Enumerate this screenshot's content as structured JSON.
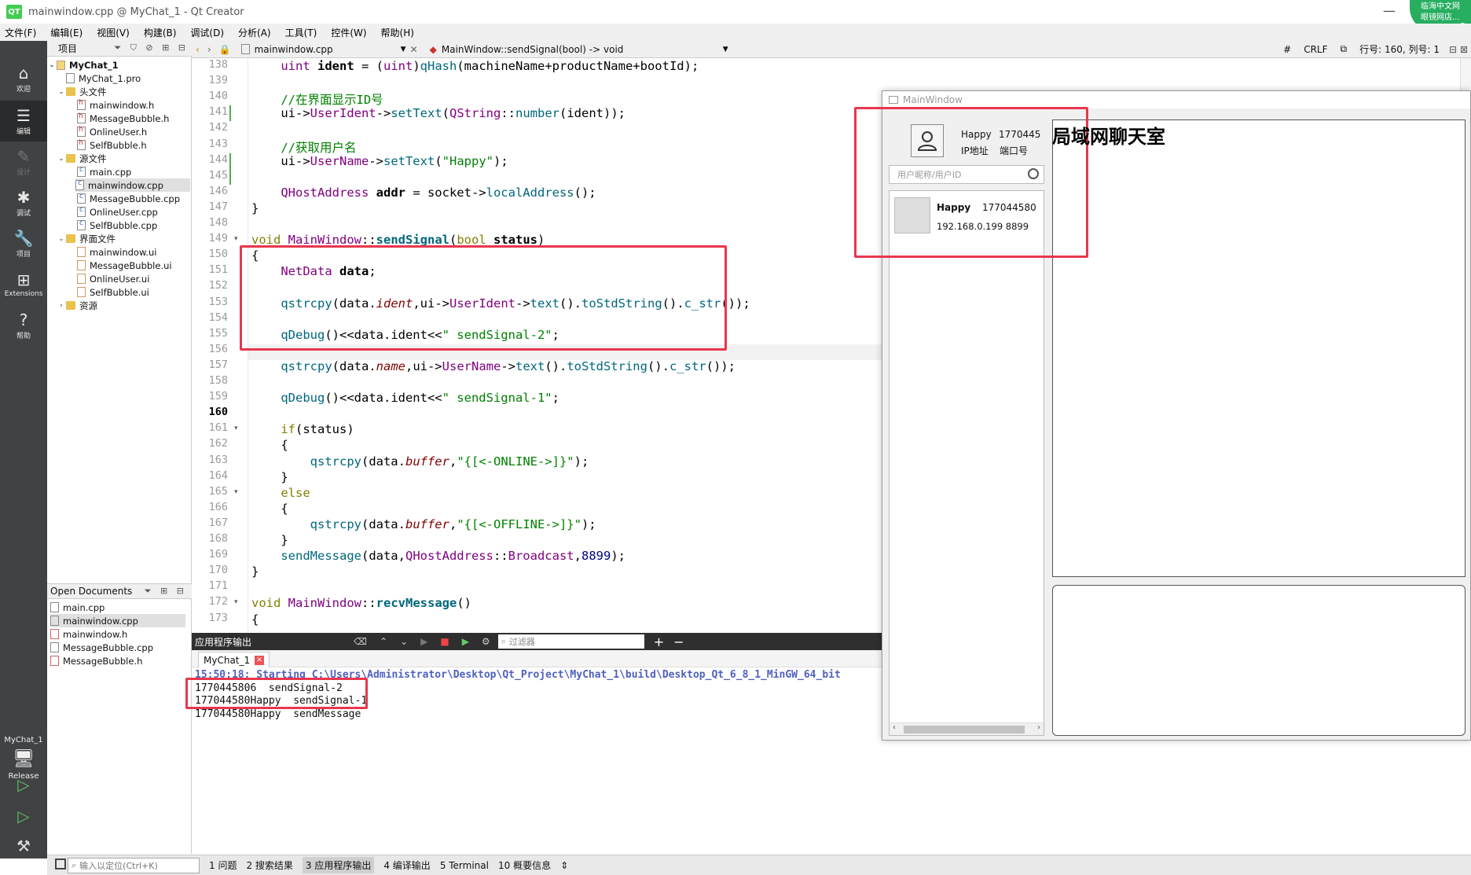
{
  "window": {
    "title": "mainwindow.cpp @ MyChat_1 - Qt Creator",
    "logo": "QT",
    "controls": [
      "—",
      "☐"
    ]
  },
  "corner_badge": {
    "line1": "临海中文网",
    "line2": "眼镜网店..."
  },
  "menu": [
    "文件(F)",
    "编辑(E)",
    "视图(V)",
    "构建(B)",
    "调试(D)",
    "分析(A)",
    "工具(T)",
    "控件(W)",
    "帮助(H)"
  ],
  "modes": [
    {
      "label": "欢迎",
      "icon": "⌂"
    },
    {
      "label": "编辑",
      "icon": "☰"
    },
    {
      "label": "设计",
      "icon": "✎"
    },
    {
      "label": "调试",
      "icon": "✱"
    },
    {
      "label": "项目",
      "icon": "🔧"
    },
    {
      "label": "Extensions",
      "icon": "⊞"
    },
    {
      "label": "帮助",
      "icon": "?"
    }
  ],
  "run_target": {
    "kit": "MyChat_1",
    "config": "Release"
  },
  "project_panel": {
    "header": "项目",
    "tree": [
      {
        "label": "MyChat_1",
        "level": 0,
        "kind": "project"
      },
      {
        "label": "MyChat_1.pro",
        "level": 1,
        "kind": "pro"
      },
      {
        "label": "头文件",
        "level": 1,
        "kind": "folder"
      },
      {
        "label": "mainwindow.h",
        "level": 2,
        "kind": "h"
      },
      {
        "label": "MessageBubble.h",
        "level": 2,
        "kind": "h"
      },
      {
        "label": "OnlineUser.h",
        "level": 2,
        "kind": "h"
      },
      {
        "label": "SelfBubble.h",
        "level": 2,
        "kind": "h"
      },
      {
        "label": "源文件",
        "level": 1,
        "kind": "folder"
      },
      {
        "label": "main.cpp",
        "level": 2,
        "kind": "c"
      },
      {
        "label": "mainwindow.cpp",
        "level": 2,
        "kind": "c"
      },
      {
        "label": "MessageBubble.cpp",
        "level": 2,
        "kind": "c"
      },
      {
        "label": "OnlineUser.cpp",
        "level": 2,
        "kind": "c"
      },
      {
        "label": "SelfBubble.cpp",
        "level": 2,
        "kind": "c"
      },
      {
        "label": "界面文件",
        "level": 1,
        "kind": "folder"
      },
      {
        "label": "mainwindow.ui",
        "level": 2,
        "kind": "ui"
      },
      {
        "label": "MessageBubble.ui",
        "level": 2,
        "kind": "ui"
      },
      {
        "label": "OnlineUser.ui",
        "level": 2,
        "kind": "ui"
      },
      {
        "label": "SelfBubble.ui",
        "level": 2,
        "kind": "ui"
      },
      {
        "label": "资源",
        "level": 1,
        "kind": "folder"
      }
    ]
  },
  "open_documents": {
    "header": "Open Documents",
    "items": [
      "main.cpp",
      "mainwindow.cpp",
      "mainwindow.h",
      "MessageBubble.cpp",
      "MessageBubble.h"
    ]
  },
  "editor_toolbar": {
    "file": "mainwindow.cpp",
    "symbol": "MainWindow::sendSignal(bool) -> void",
    "hash": "#",
    "line_ending": "CRLF",
    "position": "行号: 160, 列号: 1"
  },
  "editor": {
    "lines": [
      {
        "n": "138",
        "html": "    <span class=\"ty\">uint</span> <span class=\"bd\">ident</span> = (<span class=\"ty\">uint</span>)<span class=\"fn\">qHash</span>(machineName+productName+bootId);"
      },
      {
        "n": "139",
        "html": ""
      },
      {
        "n": "140",
        "html": "    <span class=\"cm\">//在界面显示ID号</span>"
      },
      {
        "n": "141",
        "html": "    ui-><span class=\"ty\">UserIdent</span>-><span class=\"fn\">setText</span>(<span class=\"ty\">QString</span>::<span class=\"fn\">number</span>(ident));"
      },
      {
        "n": "142",
        "html": ""
      },
      {
        "n": "143",
        "html": "    <span class=\"cm\">//获取用户名</span>"
      },
      {
        "n": "144",
        "html": "    ui-><span class=\"ty\">UserName</span>-><span class=\"fn\">setText</span>(<span class=\"st\">\"Happy\"</span>);"
      },
      {
        "n": "145",
        "html": ""
      },
      {
        "n": "146",
        "html": "    <span class=\"ty\">QHostAddress</span> <span class=\"bd\">addr</span> = socket-><span class=\"fn\">localAddress</span>();"
      },
      {
        "n": "147",
        "html": "}"
      },
      {
        "n": "148",
        "html": ""
      },
      {
        "n": "149",
        "html": "<span class=\"kw\">void</span> <span class=\"ty\">MainWindow</span>::<span class=\"bd fn\">sendSignal</span>(<span class=\"kw\">bool</span> <span class=\"bd\">status</span>)"
      },
      {
        "n": "150",
        "html": "{"
      },
      {
        "n": "151",
        "html": "    <span class=\"ty\">NetData</span> <span class=\"bd\">data</span>;"
      },
      {
        "n": "152",
        "html": ""
      },
      {
        "n": "153",
        "html": "    <span class=\"fn\">qstrcpy</span>(data.<span class=\"it\">ident</span>,ui-><span class=\"ty\">UserIdent</span>-><span class=\"fn\">text</span>().<span class=\"fn\">toStdString</span>().<span class=\"fn\">c_str</span>());"
      },
      {
        "n": "154",
        "html": ""
      },
      {
        "n": "155",
        "html": "    <span class=\"fn\">qDebug</span>()&lt;&lt;data.ident&lt;&lt;<span class=\"st\">\" sendSignal-2\"</span>;"
      },
      {
        "n": "156",
        "html": ""
      },
      {
        "n": "157",
        "html": "    <span class=\"fn\">qstrcpy</span>(data.<span class=\"it\">name</span>,ui-><span class=\"ty\">UserName</span>-><span class=\"fn\">text</span>().<span class=\"fn\">toStdString</span>().<span class=\"fn\">c_str</span>());"
      },
      {
        "n": "158",
        "html": ""
      },
      {
        "n": "159",
        "html": "    <span class=\"fn\">qDebug</span>()&lt;&lt;data.ident&lt;&lt;<span class=\"st\">\" sendSignal-1\"</span>;"
      },
      {
        "n": "160",
        "html": ""
      },
      {
        "n": "161",
        "html": "    <span class=\"kw\">if</span>(status)"
      },
      {
        "n": "162",
        "html": "    {"
      },
      {
        "n": "163",
        "html": "        <span class=\"fn\">qstrcpy</span>(data.<span class=\"it\">buffer</span>,<span class=\"st\">\"{[&lt;-ONLINE-&gt;]}\"</span>);"
      },
      {
        "n": "164",
        "html": "    }"
      },
      {
        "n": "165",
        "html": "    <span class=\"kw\">else</span>"
      },
      {
        "n": "166",
        "html": "    {"
      },
      {
        "n": "167",
        "html": "        <span class=\"fn\">qstrcpy</span>(data.<span class=\"it\">buffer</span>,<span class=\"st\">\"{[&lt;-OFFLINE-&gt;]}\"</span>);"
      },
      {
        "n": "168",
        "html": "    }"
      },
      {
        "n": "169",
        "html": "    <span class=\"fn\">sendMessage</span>(data,<span class=\"ty\">QHostAddress</span>::<span class=\"ty\">Broadcast</span>,<span class=\"nm\">8899</span>);"
      },
      {
        "n": "170",
        "html": "}"
      },
      {
        "n": "171",
        "html": ""
      },
      {
        "n": "172",
        "html": "<span class=\"kw\">void</span> <span class=\"ty\">MainWindow</span>::<span class=\"bd fn\">recvMessage</span>()"
      },
      {
        "n": "173",
        "html": "{"
      }
    ],
    "current_line": "160"
  },
  "output": {
    "header": "应用程序输出",
    "filter_placeholder": "过滤器",
    "tab": "MyChat_1",
    "lines": [
      "15:50:18: Starting C:\\Users\\Administrator\\Desktop\\Qt_Project\\MyChat_1\\build\\Desktop_Qt_6_8_1_MinGW_64_bit",
      "1770445806  sendSignal-2",
      "177044580Happy  sendSignal-1",
      "177044580Happy  sendMessage"
    ]
  },
  "statusbar": {
    "locator_placeholder": "输入以定位(Ctrl+K)",
    "tabs": [
      "1 问题",
      "2 搜索结果",
      "3 应用程序输出",
      "4 编译输出",
      "5 Terminal",
      "10 概要信息"
    ]
  },
  "app_window": {
    "title": "MainWindow",
    "user_name": "Happy",
    "user_id": "1770445",
    "ip_label": "IP地址",
    "port_label": "端口号",
    "search_placeholder": "用户昵称/用户ID",
    "users": [
      {
        "name": "Happy",
        "id": "177044580",
        "addr": "192.168.0.199 8899"
      }
    ],
    "chat_title": "局域网聊天室"
  }
}
